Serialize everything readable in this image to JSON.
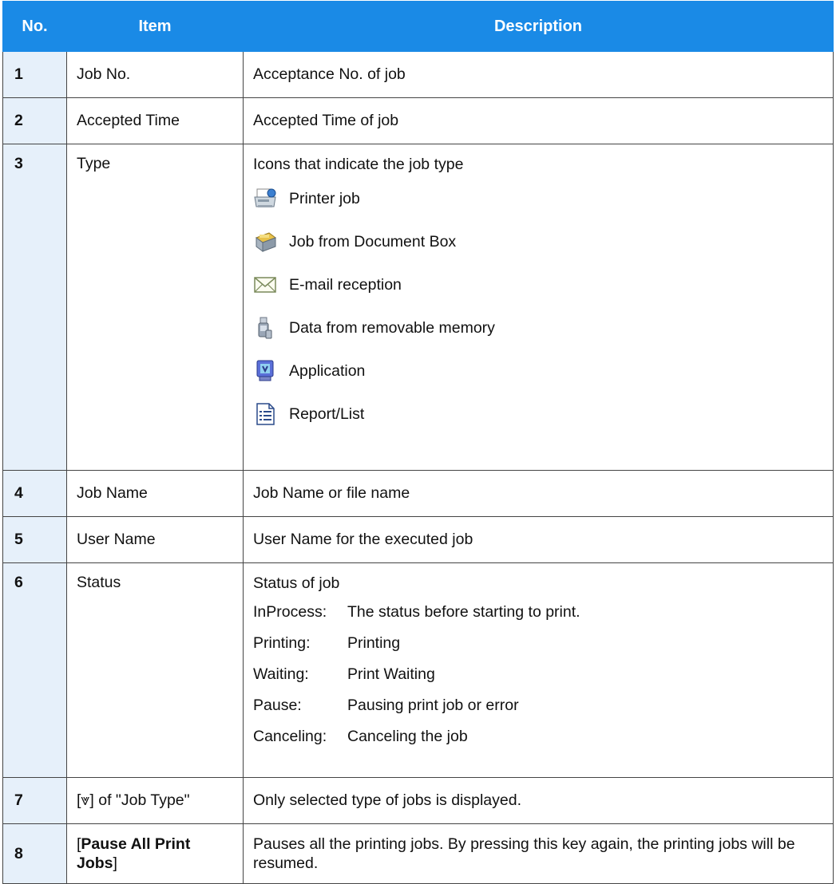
{
  "header": {
    "no": "No.",
    "item": "Item",
    "description": "Description"
  },
  "rows": [
    {
      "no": "1",
      "item": "Job No.",
      "description": "Acceptance No. of job"
    },
    {
      "no": "2",
      "item": "Accepted Time",
      "description": "Accepted Time of job"
    },
    {
      "no": "3",
      "item": "Type",
      "description": "Icons that indicate the job type",
      "types": [
        {
          "label": "Printer job",
          "icon": "printer-icon"
        },
        {
          "label": "Job from Document Box",
          "icon": "document-box-icon"
        },
        {
          "label": "E-mail reception",
          "icon": "email-icon"
        },
        {
          "label": "Data from removable memory",
          "icon": "usb-memory-icon"
        },
        {
          "label": "Application",
          "icon": "application-icon"
        },
        {
          "label": "Report/List",
          "icon": "report-list-icon"
        }
      ]
    },
    {
      "no": "4",
      "item": "Job Name",
      "description": "Job Name or file name"
    },
    {
      "no": "5",
      "item": "User Name",
      "description": "User Name for the executed job"
    },
    {
      "no": "6",
      "item": "Status",
      "description": "Status of job",
      "statuses": [
        {
          "key": "InProcess:",
          "value": "The status before starting to print."
        },
        {
          "key": "Printing:",
          "value": "Printing"
        },
        {
          "key": "Waiting:",
          "value": "Print Waiting"
        },
        {
          "key": "Pause:",
          "value": "Pausing print job or error"
        },
        {
          "key": "Canceling:",
          "value": "Canceling the job"
        }
      ]
    },
    {
      "no": "7",
      "item": "[⩔] of \"Job Type\"",
      "description": "Only selected type of jobs is displayed."
    },
    {
      "no": "8",
      "item_prefix": "[",
      "item_bold": "Pause All Print Jobs",
      "item_suffix": "]",
      "description": "Pauses all the printing jobs. By pressing this key again, the printing jobs will be resumed."
    }
  ],
  "colors": {
    "header_bg": "#1a8ae6",
    "number_cell_bg": "#e6f0fa",
    "border": "#444444"
  }
}
